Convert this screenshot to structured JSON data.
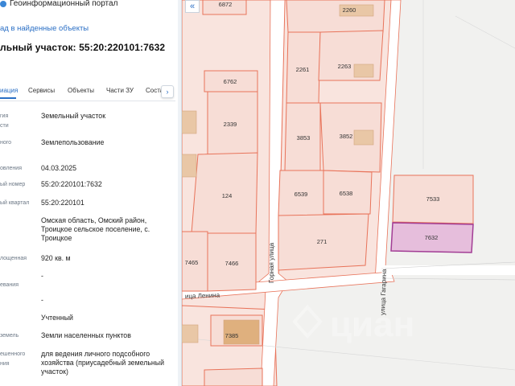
{
  "header": {
    "title": "Геоинформационный портал"
  },
  "back_link": "ад в найденные объекты",
  "page_title": "льный участок: 55:20:220101:7632",
  "tabs": [
    {
      "label": "иация",
      "active": true
    },
    {
      "label": "Сервисы",
      "active": false
    },
    {
      "label": "Объекты",
      "active": false
    },
    {
      "label": "Части ЗУ",
      "active": false
    },
    {
      "label": "Соста",
      "active": false
    }
  ],
  "tabs_next_icon": "›",
  "collapse_icon": "«",
  "fields": [
    {
      "label": "гия",
      "label2": "сти",
      "value": "Земельный участок"
    },
    {
      "label": "ного",
      "value": "Землепользование"
    },
    {
      "label": "овления",
      "value": "04.03.2025"
    },
    {
      "label": "ый номер",
      "value": "55:20:220101:7632"
    },
    {
      "label": "ый квартал",
      "value": "55:20:220101"
    },
    {
      "label": "",
      "value": "Омская область, Омский район, Троицкое сельское поселение, с. Троицкое"
    },
    {
      "label": "лощенная",
      "value": "920 кв. м"
    },
    {
      "label": "евания",
      "value": "-"
    },
    {
      "label": "",
      "value": "-"
    },
    {
      "label": "",
      "value": "Учтенный"
    },
    {
      "label": "земель",
      "value": "Земли населенных пунктов"
    },
    {
      "label": "ешенного",
      "label2": "ния",
      "value": "для ведения личного подсобного хозяйства (приусадебный земельный участок)"
    }
  ],
  "map": {
    "parcels": [
      "6872",
      "2260",
      "2261",
      "2263",
      "6762",
      "2339",
      "3853",
      "3852",
      "6539",
      "6538",
      "124",
      "271",
      "7465",
      "7466",
      "7533",
      "7632",
      "7385"
    ],
    "streets": [
      "Горная улица",
      "улица Гагарина",
      "ица Ленина"
    ],
    "watermark": "циан",
    "colors": {
      "parcel_fill": "#f7ddd6",
      "parcel_stroke": "#e8735a",
      "selected_fill": "#e6bedc",
      "selected_stroke": "#a23d95",
      "building": "#e9c7a6",
      "road": "#ffffff"
    }
  }
}
